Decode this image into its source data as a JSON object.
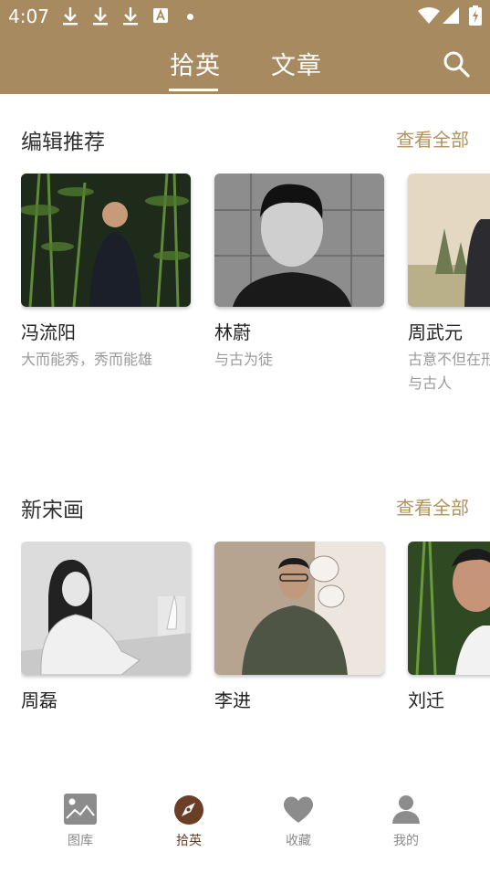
{
  "status_bar": {
    "time": "4:07"
  },
  "top_tabs": [
    {
      "label": "拾英",
      "active": true
    },
    {
      "label": "文章",
      "active": false
    }
  ],
  "sections": [
    {
      "title": "编辑推荐",
      "see_all": "查看全部",
      "cards": [
        {
          "name": "冯流阳",
          "desc": "大而能秀，秀而能雄"
        },
        {
          "name": "林蔚",
          "desc": "与古为徒"
        },
        {
          "name": "周武元",
          "desc": "古意不但在形似，更在于与古人"
        }
      ]
    },
    {
      "title": "新宋画",
      "see_all": "查看全部",
      "cards": [
        {
          "name": "周磊",
          "desc": ""
        },
        {
          "name": "李进",
          "desc": ""
        },
        {
          "name": "刘迁",
          "desc": ""
        }
      ]
    }
  ],
  "bottom_nav": [
    {
      "label": "图库",
      "icon": "gallery-icon",
      "active": false
    },
    {
      "label": "拾英",
      "icon": "compass-icon",
      "active": true
    },
    {
      "label": "收藏",
      "icon": "heart-icon",
      "active": false
    },
    {
      "label": "我的",
      "icon": "person-icon",
      "active": false
    }
  ],
  "colors": {
    "header": "#a88a60",
    "accent_text": "#b1925f",
    "active_nav": "#6b3f25",
    "inactive_nav": "#8a8a8a"
  }
}
